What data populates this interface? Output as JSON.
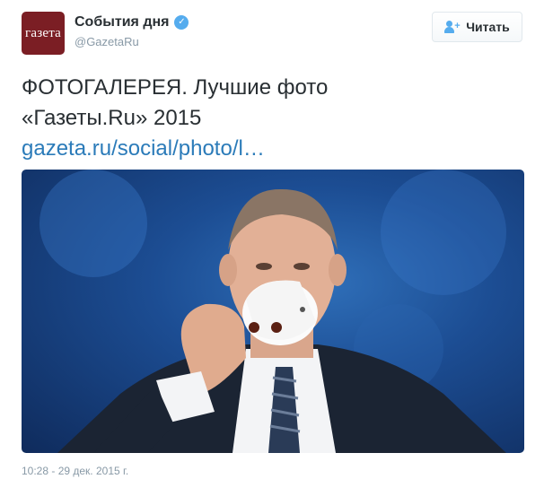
{
  "tweet": {
    "avatar_text": "газета",
    "fullname": "События дня",
    "verified_mark": "✓",
    "username": "@GazetaRu",
    "follow_label": "Читать",
    "text_line1": "ФОТОГАЛЕРЕЯ. Лучшие фото",
    "text_line2": "«Газеты.Ru» 2015",
    "link_text": "gazeta.ru/social/photo/l…",
    "timestamp": "10:28 - 29 дек. 2015 г."
  },
  "icons": {
    "verified": "verified-badge-icon",
    "follow": "follow-user-plus-icon"
  },
  "colors": {
    "link": "#2b7bb9",
    "verified": "#55acee",
    "avatar_bg": "#7b1e24",
    "muted": "#8899a6"
  }
}
